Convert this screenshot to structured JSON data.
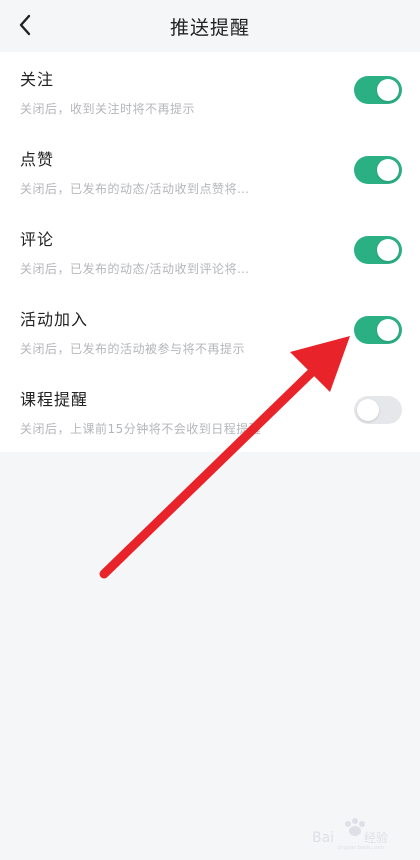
{
  "header": {
    "title": "推送提醒",
    "back_icon": "chevron-left-icon"
  },
  "settings": [
    {
      "title": "关注",
      "desc": "关闭后，收到关注时将不再提示",
      "enabled": true
    },
    {
      "title": "点赞",
      "desc": "关闭后，已发布的动态/活动收到点赞将…",
      "enabled": true
    },
    {
      "title": "评论",
      "desc": "关闭后，已发布的动态/活动收到评论将…",
      "enabled": true
    },
    {
      "title": "活动加入",
      "desc": "关闭后，已发布的活动被参与将不再提示",
      "enabled": true
    },
    {
      "title": "课程提醒",
      "desc": "关闭后，上课前15分钟将不会收到日程提醒",
      "enabled": false
    }
  ],
  "colors": {
    "toggle_on": "#2bb084",
    "toggle_off": "#e6e7ea",
    "annotation_arrow": "#e8232a"
  },
  "watermark": {
    "text": "Baidu经验",
    "url": "jingyan.baidu.com"
  }
}
